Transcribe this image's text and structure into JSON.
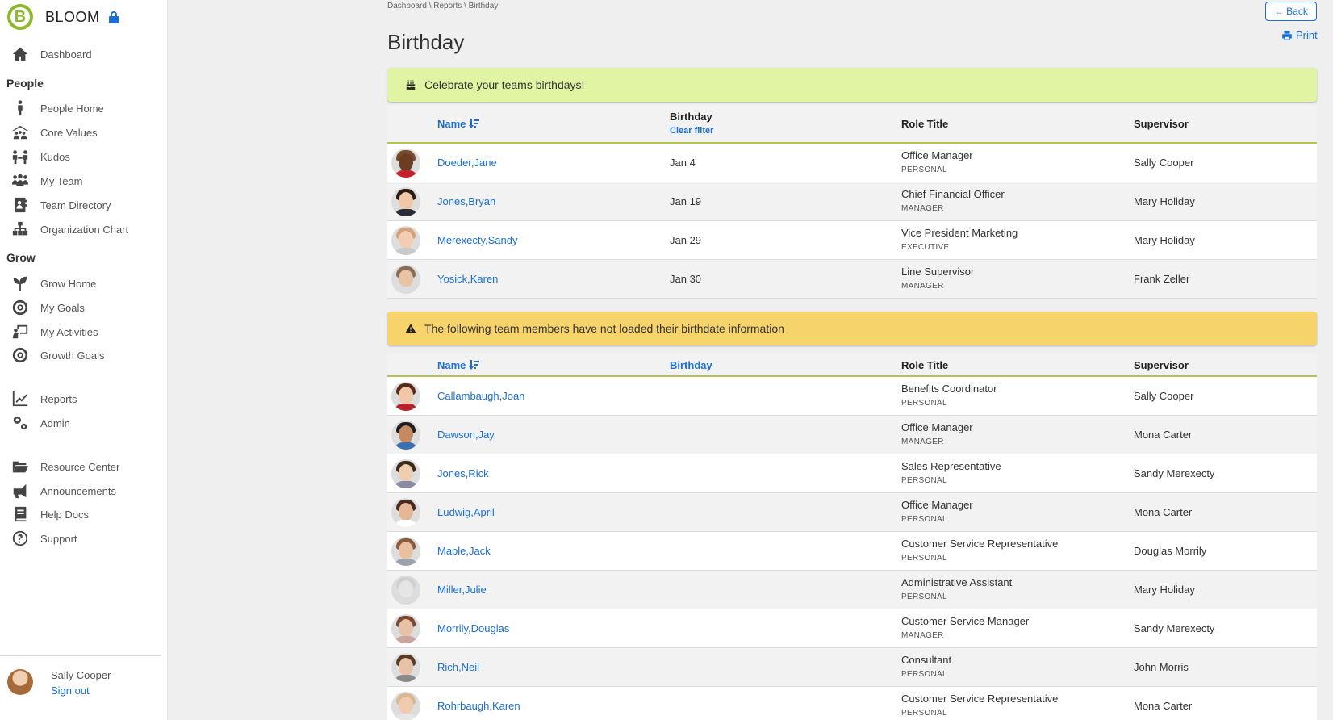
{
  "brand": {
    "name": "BLOOM",
    "logo_letter": "B",
    "lock_icon": "lock-icon"
  },
  "sidebar": {
    "dashboard": {
      "label": "Dashboard",
      "icon": "home-icon"
    },
    "section_people": "People",
    "people_items": [
      {
        "label": "People Home",
        "icon": "person-icon"
      },
      {
        "label": "Core Values",
        "icon": "core-values-icon"
      },
      {
        "label": "Kudos",
        "icon": "kudos-icon"
      },
      {
        "label": "My Team",
        "icon": "team-icon"
      },
      {
        "label": "Team Directory",
        "icon": "directory-icon"
      },
      {
        "label": "Organization Chart",
        "icon": "org-chart-icon"
      }
    ],
    "section_grow": "Grow",
    "grow_items": [
      {
        "label": "Grow Home",
        "icon": "sprout-icon"
      },
      {
        "label": "My Goals",
        "icon": "target-icon"
      },
      {
        "label": "My Activities",
        "icon": "activities-icon"
      },
      {
        "label": "Growth Goals",
        "icon": "target-icon"
      }
    ],
    "tools_items": [
      {
        "label": "Reports",
        "icon": "chart-line-icon"
      },
      {
        "label": "Admin",
        "icon": "gears-icon"
      }
    ],
    "resource_items": [
      {
        "label": "Resource Center",
        "icon": "folder-open-icon"
      },
      {
        "label": "Announcements",
        "icon": "megaphone-icon"
      },
      {
        "label": "Help Docs",
        "icon": "book-icon"
      },
      {
        "label": "Support",
        "icon": "question-circle-icon"
      }
    ],
    "user": {
      "name": "Sally Cooper",
      "signout": "Sign out"
    }
  },
  "breadcrumb": "Dashboard \\ Reports \\ Birthday",
  "page_title": "Birthday",
  "back_label": "Back",
  "print_label": "Print",
  "alert_celebrate": "Celebrate your teams birthdays!",
  "alert_missing": "The following team members have not loaded their birthdate information",
  "table1": {
    "headers": {
      "name": "Name",
      "birthday": "Birthday",
      "clear_filter": "Clear filter",
      "role": "Role Title",
      "supervisor": "Supervisor"
    },
    "rows": [
      {
        "name": "Doeder,Jane",
        "birthday": "Jan 4",
        "role": "Office Manager",
        "tag": "PERSONAL",
        "supervisor": "Sally Cooper"
      },
      {
        "name": "Jones,Bryan",
        "birthday": "Jan 19",
        "role": "Chief Financial Officer",
        "tag": "MANAGER",
        "supervisor": "Mary Holiday"
      },
      {
        "name": "Merexecty,Sandy",
        "birthday": "Jan 29",
        "role": "Vice President Marketing",
        "tag": "EXECUTIVE",
        "supervisor": "Mary Holiday"
      },
      {
        "name": "Yosick,Karen",
        "birthday": "Jan 30",
        "role": "Line Supervisor",
        "tag": "MANAGER",
        "supervisor": "Frank Zeller"
      }
    ]
  },
  "table2": {
    "headers": {
      "name": "Name",
      "birthday": "Birthday",
      "role": "Role Title",
      "supervisor": "Supervisor"
    },
    "rows": [
      {
        "name": "Callambaugh,Joan",
        "birthday": "",
        "role": "Benefits Coordinator",
        "tag": "PERSONAL",
        "supervisor": "Sally Cooper"
      },
      {
        "name": "Dawson,Jay",
        "birthday": "",
        "role": "Office Manager",
        "tag": "MANAGER",
        "supervisor": "Mona Carter"
      },
      {
        "name": "Jones,Rick",
        "birthday": "",
        "role": "Sales Representative",
        "tag": "PERSONAL",
        "supervisor": "Sandy Merexecty"
      },
      {
        "name": "Ludwig,April",
        "birthday": "",
        "role": "Office Manager",
        "tag": "PERSONAL",
        "supervisor": "Mona Carter"
      },
      {
        "name": "Maple,Jack",
        "birthday": "",
        "role": "Customer Service Representative",
        "tag": "PERSONAL",
        "supervisor": "Douglas Morrily"
      },
      {
        "name": "Miller,Julie",
        "birthday": "",
        "role": "Administrative Assistant",
        "tag": "PERSONAL",
        "supervisor": "Mary Holiday"
      },
      {
        "name": "Morrily,Douglas",
        "birthday": "",
        "role": "Customer Service Manager",
        "tag": "MANAGER",
        "supervisor": "Sandy Merexecty"
      },
      {
        "name": "Rich,Neil",
        "birthday": "",
        "role": "Consultant",
        "tag": "PERSONAL",
        "supervisor": "John Morris"
      },
      {
        "name": "Rohrbaugh,Karen",
        "birthday": "",
        "role": "Customer Service Representative",
        "tag": "PERSONAL",
        "supervisor": "Mona Carter"
      }
    ]
  },
  "colors": {
    "accent": "#1a6fd6",
    "brand": "#8fb82e",
    "celebrate_bg": "#e1f4a3",
    "warning_bg": "#f6d36b"
  }
}
